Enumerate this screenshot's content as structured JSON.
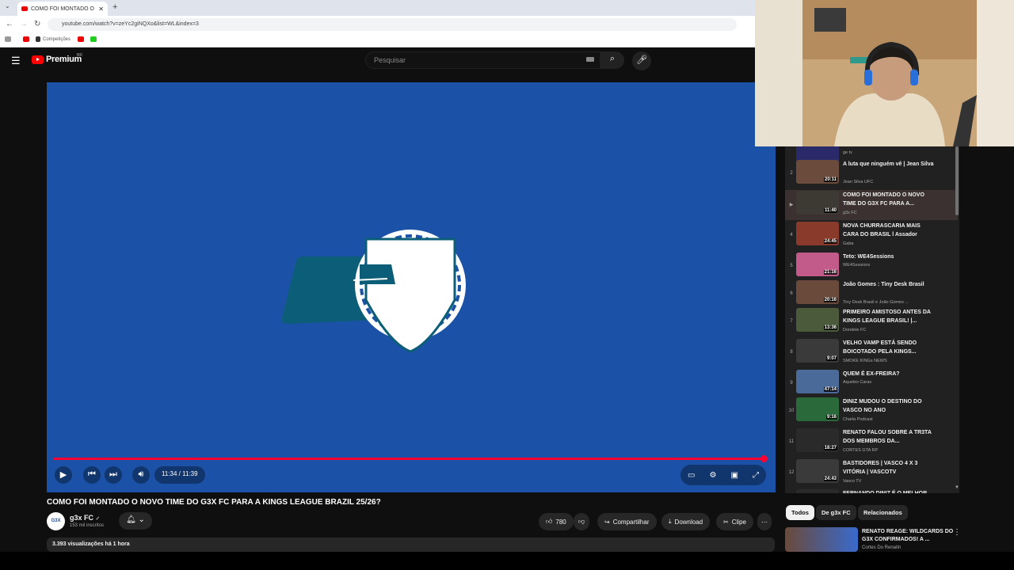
{
  "browser": {
    "tab_title": "COMO FOI MONTADO O NOVO",
    "tab_close": "✕",
    "new_tab": "+",
    "url": "youtube.com/watch?v=zeYc2giNQXo&list=WL&index=3",
    "bookmark_1": "Competições"
  },
  "header": {
    "logo_text": "Premium",
    "logo_region": "BR",
    "search_placeholder": "Pesquisar"
  },
  "player": {
    "time": "11:34 / 11:39",
    "progress": 0.993
  },
  "video": {
    "title": "COMO FOI MONTADO O NOVO TIME DO G3X FC PARA A KINGS LEAGUE BRAZIL 25/26?",
    "channel_name": "g3x FC",
    "channel_avatar": "G3X",
    "channel_subs": "153 mil inscritos",
    "likes": "780",
    "share": "Compartilhar",
    "download": "Download",
    "clip": "Clipe",
    "views_time": "3.393 visualizações  há 1 hora"
  },
  "playlist": {
    "items": [
      {
        "idx": "",
        "title": "",
        "channel": "ge tv",
        "duration": "4:49"
      },
      {
        "idx": "2",
        "title": "A luta que ninguém vê | Jean Silva",
        "channel": "Jean Silva UFC",
        "duration": "20:11"
      },
      {
        "idx": "▶",
        "title": "COMO FOI MONTADO O NOVO TIME DO G3X FC PARA A...",
        "channel": "g3x FC",
        "duration": "11:40"
      },
      {
        "idx": "4",
        "title": "NOVA CHURRASCARIA MAIS CARA DO BRASIL l Assador",
        "channel": "Gaba",
        "duration": "24:45"
      },
      {
        "idx": "5",
        "title": "Teto: WE4Sessions",
        "channel": "WE4Sessions",
        "duration": "21:16"
      },
      {
        "idx": "6",
        "title": "João Gomes : Tiny Desk Brasil",
        "channel": "Tiny Desk Brasil e João Gomes ...",
        "duration": "20:16"
      },
      {
        "idx": "7",
        "title": "PRIMEIRO AMISTOSO ANTES DA KINGS LEAGUE BRASIL! |...",
        "channel": "Dondele FC",
        "duration": "13:36"
      },
      {
        "idx": "8",
        "title": "VELHO VAMP ESTÁ SENDO BOICOTADO PELA KINGS...",
        "channel": "SMOKE KINGs NEWS",
        "duration": "9:07"
      },
      {
        "idx": "9",
        "title": "QUEM É EX-FREIRA?",
        "channel": "Aqueles Caras",
        "duration": "47:14"
      },
      {
        "idx": "10",
        "title": "DINIZ MUDOU O DESTINO DO VASCO NO ANO",
        "channel": "Charla Podcast",
        "duration": "9:16"
      },
      {
        "idx": "11",
        "title": "RENATO FALOU SOBRE A TR3TA DOS MEMBROS DA...",
        "channel": "CORTES GTA RP",
        "duration": "18:27"
      },
      {
        "idx": "12",
        "title": "BASTIDORES | VASCO 4 X 3 VITÓRIA | VASCOTV",
        "channel": "Vasco TV",
        "duration": "24:43"
      },
      {
        "idx": "",
        "title": "FERNANDO DINIZ É O MELHOR",
        "channel": "",
        "duration": ""
      }
    ]
  },
  "chips": [
    "Todos",
    "De g3x FC",
    "Relacionados"
  ],
  "recommendation": {
    "title": "RENATO REAGE: WILDCARDS DO G3X CONFIRMADOS! A ...",
    "channel": "Cortes Do Renatin"
  },
  "colors": {
    "player_bg": "#1b52a8",
    "progress": "#ff0033",
    "yt_red": "#ff0000",
    "active_row": "#3a3130"
  }
}
